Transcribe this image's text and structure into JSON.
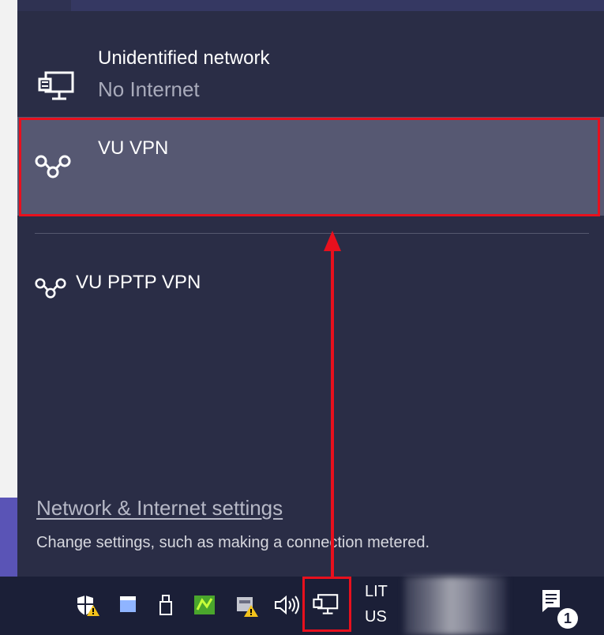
{
  "networks": [
    {
      "name": "Unidentified network",
      "status": "No Internet",
      "icon": "wired-network-icon"
    },
    {
      "name": "VU VPN",
      "icon": "vpn-icon",
      "highlighted": true
    },
    {
      "name": "VU PPTP VPN",
      "icon": "vpn-icon"
    }
  ],
  "settings": {
    "link_label": "Network & Internet settings",
    "description": "Change settings, such as making a connection metered."
  },
  "taskbar": {
    "language_top": "LIT",
    "language_bottom": "US",
    "notification_count": "1",
    "tray_icons": [
      "security-shield-icon",
      "window-icon",
      "usb-icon",
      "green-app-icon",
      "vmware-icon",
      "volume-icon",
      "network-icon",
      "notification-icon"
    ]
  },
  "colors": {
    "annotation": "#e8101d",
    "flyout_bg": "#2a2d46",
    "selected_bg": "#565872"
  }
}
